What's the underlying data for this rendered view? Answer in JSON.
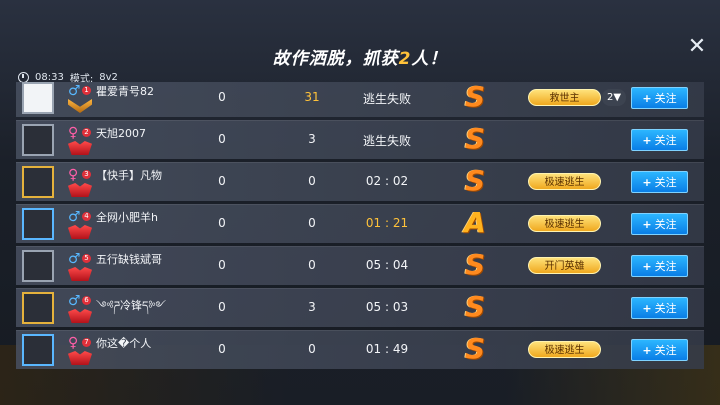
{
  "header": {
    "title_prefix": "故作洒脱，抓获",
    "title_count": "2",
    "title_suffix": "人！",
    "time": "08:33",
    "mode_label": "模式:",
    "mode_value": "8v2"
  },
  "colors": {
    "accent_gold": "#ffc23a",
    "follow_blue": "#0a7ee6"
  },
  "follow_label": "关注",
  "rows": [
    {
      "gender": "♂",
      "gender_class": "male",
      "rank": "1",
      "name": "瞿爱青号82",
      "col1": "0",
      "col2": "31",
      "col2_hl": true,
      "result": "逃生失败",
      "result_hl": false,
      "grade": "S",
      "tag": "救世主",
      "more": "2▼",
      "badge": "gold",
      "avatar": "empty"
    },
    {
      "gender": "♀",
      "gender_class": "female",
      "rank": "2",
      "name": "天旭2007",
      "col1": "0",
      "col2": "3",
      "col2_hl": false,
      "result": "逃生失败",
      "result_hl": false,
      "grade": "S",
      "tag": "",
      "more": "",
      "badge": "red",
      "avatar": "normal"
    },
    {
      "gender": "♀",
      "gender_class": "female",
      "rank": "3",
      "name": "【快手】凡物",
      "col1": "0",
      "col2": "0",
      "col2_hl": false,
      "result": "02 : 02",
      "result_hl": false,
      "grade": "S",
      "tag": "极速逃生",
      "more": "",
      "badge": "red",
      "avatar": "gold"
    },
    {
      "gender": "♂",
      "gender_class": "male",
      "rank": "4",
      "name": "全网小肥羊h",
      "col1": "0",
      "col2": "0",
      "col2_hl": false,
      "result": "01 : 21",
      "result_hl": true,
      "grade": "A",
      "tag": "极速逃生",
      "more": "",
      "badge": "red",
      "avatar": "blue"
    },
    {
      "gender": "♂",
      "gender_class": "male",
      "rank": "5",
      "name": "五行缺钱斌哥",
      "col1": "0",
      "col2": "0",
      "col2_hl": false,
      "result": "05 : 04",
      "result_hl": false,
      "grade": "S",
      "tag": "开门英雄",
      "more": "",
      "badge": "red",
      "avatar": "normal"
    },
    {
      "gender": "♂",
      "gender_class": "male",
      "rank": "6",
      "name": "༺ཌ冷锋ད༻",
      "col1": "0",
      "col2": "3",
      "col2_hl": false,
      "result": "05 : 03",
      "result_hl": false,
      "grade": "S",
      "tag": "",
      "more": "",
      "badge": "red",
      "avatar": "gold"
    },
    {
      "gender": "♀",
      "gender_class": "female",
      "rank": "7",
      "name": "你这�个人",
      "col1": "0",
      "col2": "0",
      "col2_hl": false,
      "result": "01 : 49",
      "result_hl": false,
      "grade": "S",
      "tag": "极速逃生",
      "more": "",
      "badge": "red",
      "avatar": "blue"
    }
  ]
}
